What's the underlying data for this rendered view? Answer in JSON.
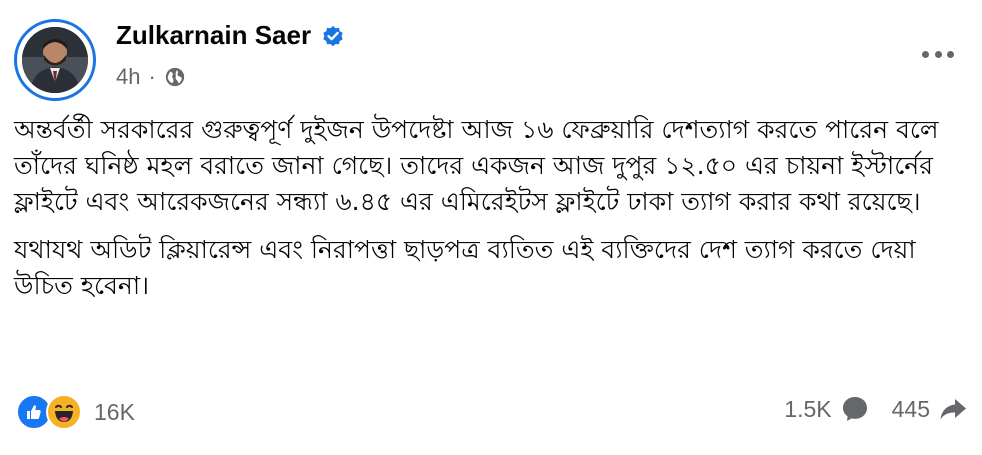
{
  "post": {
    "author": "Zulkarnain Saer",
    "time": "4h",
    "separator": "·",
    "paragraphs": [
      "অন্তর্বর্তী সরকারের গুরুত্বপূর্ণ দুইজন উপদেষ্টা আজ ১৬ ফেব্রুয়ারি দেশত্যাগ করতে পারেন বলে তাঁদের ঘনিষ্ঠ মহল বরাতে জানা গেছে। তাদের একজন আজ দুপুর ১২.৫০ এর চায়না ইস্টার্নের ফ্লাইটে এবং আরেকজনের সন্ধ্যা ৬.৪৫ এর এমিরেইটস ফ্লাইটে ঢাকা ত্যাগ করার কথা রয়েছে।",
      "যথাযথ অডিট ক্লিয়ারেন্স এবং নিরাপত্তা ছাড়পত্র ব্যতিত এই ব্যক্তিদের দেশ ত্যাগ করতে দেয়া উচিত হবেনা।"
    ]
  },
  "footer": {
    "reaction_count": "16K",
    "comments_count": "1.5K",
    "shares_count": "445"
  },
  "icons": {
    "verified": "verified-badge-icon",
    "privacy": "globe-icon",
    "more": "more-options-icon",
    "like": "like-reaction-icon",
    "haha": "haha-reaction-icon",
    "comment": "comment-icon",
    "share": "share-icon"
  },
  "colors": {
    "accent": "#1b74e4",
    "like": "#1877f2",
    "haha": "#f7b125",
    "secondary_text": "#65676b"
  }
}
